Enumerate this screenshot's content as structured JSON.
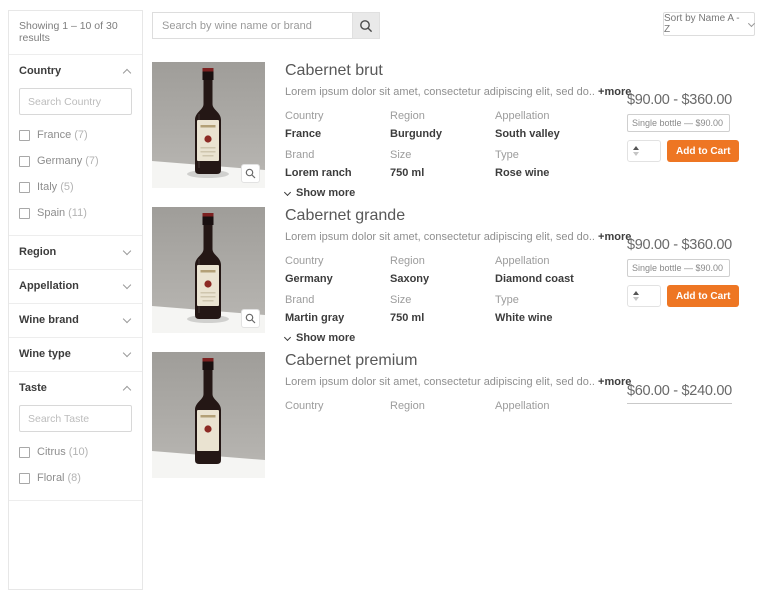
{
  "colors": {
    "accent": "#ee7623"
  },
  "sidebar": {
    "results_text": "Showing 1 – 10 of 30 results",
    "country": {
      "label": "Country",
      "search_placeholder": "Search Country",
      "options": [
        {
          "name": "France",
          "count": "(7)"
        },
        {
          "name": "Germany",
          "count": "(7)"
        },
        {
          "name": "Italy",
          "count": "(5)"
        },
        {
          "name": "Spain",
          "count": "(11)"
        }
      ]
    },
    "region_label": "Region",
    "appellation_label": "Appellation",
    "wine_brand_label": "Wine brand",
    "wine_type_label": "Wine type",
    "taste": {
      "label": "Taste",
      "search_placeholder": "Search Taste",
      "options": [
        {
          "name": "Citrus",
          "count": "(10)"
        },
        {
          "name": "Floral",
          "count": "(8)"
        }
      ]
    }
  },
  "topbar": {
    "search_placeholder": "Search by wine name or brand",
    "sort_label": "Sort by Name A - Z"
  },
  "products": [
    {
      "title": "Cabernet brut",
      "description": "Lorem ipsum dolor sit amet, consectetur adipiscing elit, sed do..",
      "more_label": "+more",
      "fields": [
        {
          "label": "Country",
          "value": "France"
        },
        {
          "label": "Region",
          "value": "Burgundy"
        },
        {
          "label": "Appellation",
          "value": "South valley"
        },
        {
          "label": "Brand",
          "value": "Lorem ranch"
        },
        {
          "label": "Size",
          "value": "750 ml"
        },
        {
          "label": "Type",
          "value": "Rose wine"
        }
      ],
      "show_more_label": "Show more",
      "price_range": "$90.00 - $360.00",
      "variant": "Single bottle — $90.00",
      "add_to_cart_label": "Add to Cart"
    },
    {
      "title": "Cabernet grande",
      "description": "Lorem ipsum dolor sit amet, consectetur adipiscing elit, sed do..",
      "more_label": "+more",
      "fields": [
        {
          "label": "Country",
          "value": "Germany"
        },
        {
          "label": "Region",
          "value": "Saxony"
        },
        {
          "label": "Appellation",
          "value": "Diamond coast"
        },
        {
          "label": "Brand",
          "value": "Martin gray"
        },
        {
          "label": "Size",
          "value": "750 ml"
        },
        {
          "label": "Type",
          "value": "White wine"
        }
      ],
      "show_more_label": "Show more",
      "price_range": "$90.00 - $360.00",
      "variant": "Single bottle — $90.00",
      "add_to_cart_label": "Add to Cart"
    },
    {
      "title": "Cabernet premium",
      "description": "Lorem ipsum dolor sit amet, consectetur adipiscing elit, sed do..",
      "more_label": "+more",
      "fields": [
        {
          "label": "Country",
          "value": ""
        },
        {
          "label": "Region",
          "value": ""
        },
        {
          "label": "Appellation",
          "value": ""
        }
      ],
      "price_range": "$60.00 - $240.00"
    }
  ]
}
